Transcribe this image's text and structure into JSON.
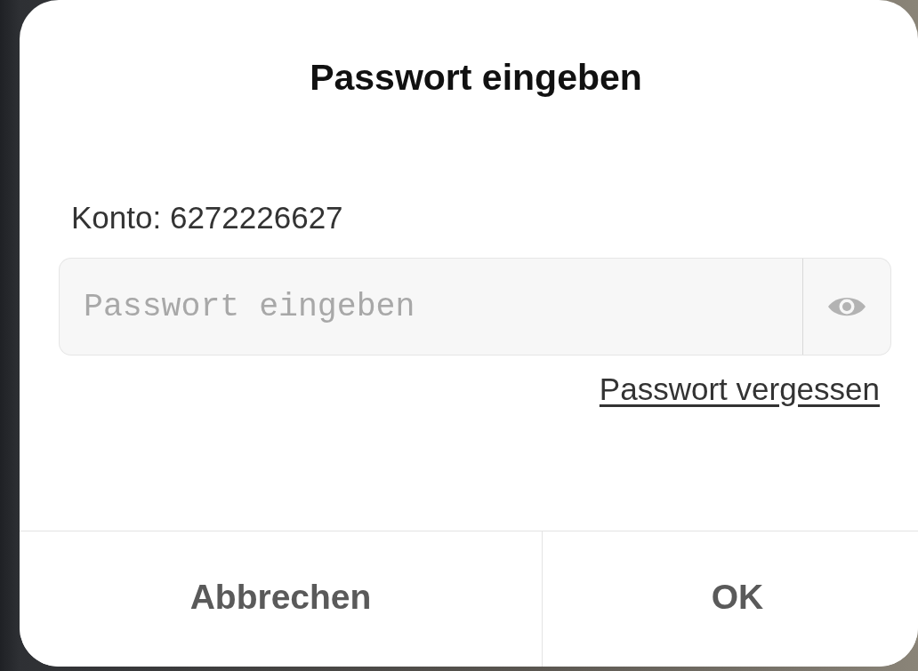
{
  "dialog": {
    "title": "Passwort eingeben",
    "account_label": "Konto: 6272226627",
    "password_field": {
      "placeholder": "Passwort eingeben"
    },
    "forgot_link": "Passwort vergessen",
    "buttons": [
      "Abbrechen",
      "OK"
    ]
  }
}
